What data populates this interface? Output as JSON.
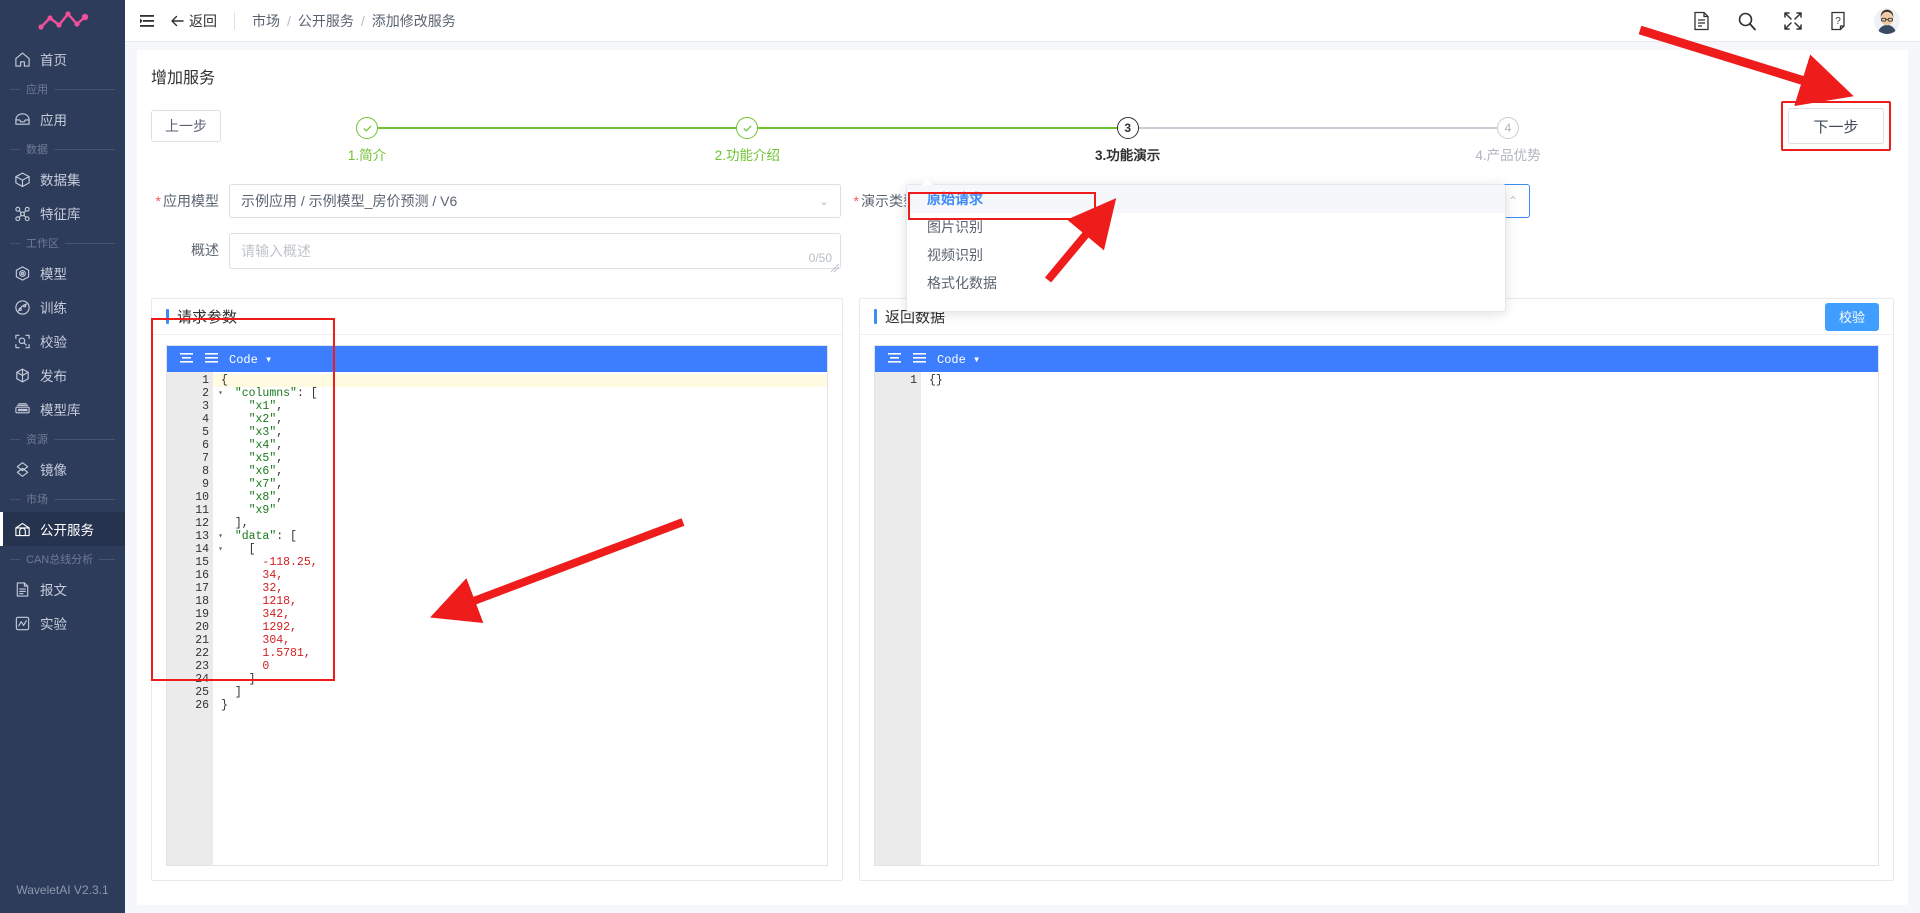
{
  "app": {
    "name": "WaveletAI V2.3.1",
    "logo_icon": "wave-logo-icon"
  },
  "sidebar": {
    "items": [
      {
        "type": "item",
        "label": "首页",
        "icon": "home-icon",
        "active": false
      },
      {
        "type": "group",
        "label": "应用"
      },
      {
        "type": "item",
        "label": "应用",
        "icon": "inbox-icon",
        "active": false
      },
      {
        "type": "group",
        "label": "数据"
      },
      {
        "type": "item",
        "label": "数据集",
        "icon": "cube-icon",
        "active": false
      },
      {
        "type": "item",
        "label": "特征库",
        "icon": "nodes-icon",
        "active": false
      },
      {
        "type": "group",
        "label": "工作区"
      },
      {
        "type": "item",
        "label": "模型",
        "icon": "model-icon",
        "active": false
      },
      {
        "type": "item",
        "label": "训练",
        "icon": "train-icon",
        "active": false
      },
      {
        "type": "item",
        "label": "校验",
        "icon": "verify-icon",
        "active": false
      },
      {
        "type": "item",
        "label": "发布",
        "icon": "package-icon",
        "active": false
      },
      {
        "type": "item",
        "label": "模型库",
        "icon": "library-icon",
        "active": false
      },
      {
        "type": "group",
        "label": "资源"
      },
      {
        "type": "item",
        "label": "镜像",
        "icon": "image-icon",
        "active": false
      },
      {
        "type": "group",
        "label": "市场"
      },
      {
        "type": "item",
        "label": "公开服务",
        "icon": "store-icon",
        "active": true
      },
      {
        "type": "group",
        "label": "CAN总线分析"
      },
      {
        "type": "item",
        "label": "报文",
        "icon": "doc-icon",
        "active": false
      },
      {
        "type": "item",
        "label": "实验",
        "icon": "experiment-icon",
        "active": false
      }
    ]
  },
  "topbar": {
    "collapse_icon": "menu-collapse-icon",
    "back_label": "返回",
    "back_icon": "arrow-left-icon",
    "breadcrumbs": [
      "市场",
      "公开服务",
      "添加修改服务"
    ],
    "separator": "/",
    "icons": [
      "document-icon",
      "search-icon",
      "fullscreen-icon",
      "help-icon"
    ],
    "avatar_icon": "user-avatar"
  },
  "page": {
    "title": "增加服务",
    "prev_button": "上一步",
    "next_button": "下一步"
  },
  "stepper": {
    "steps": [
      {
        "label": "1.简介",
        "marker": "check",
        "state": "done"
      },
      {
        "label": "2.功能介绍",
        "marker": "check",
        "state": "done"
      },
      {
        "label": "3.功能演示",
        "marker": "3",
        "state": "current"
      },
      {
        "label": "4.产品优势",
        "marker": "4",
        "state": "todo"
      }
    ],
    "done_color": "#6fc231",
    "todo_color": "#c8ccd4"
  },
  "form": {
    "app_model": {
      "label": "应用模型",
      "required": true,
      "value": "示例应用 / 示例模型_房价预测 / V6"
    },
    "summary": {
      "label": "概述",
      "required": false,
      "value": "",
      "placeholder": "请输入概述",
      "counter": "0/50"
    },
    "demo_type": {
      "label": "演示类型",
      "required": true,
      "value": "原始请求",
      "expanded": true,
      "options": [
        "原始请求",
        "图片识别",
        "视频识别",
        "格式化数据"
      ],
      "selected": "原始请求"
    }
  },
  "left_panel": {
    "title": "请求参数",
    "editor": {
      "mode_label": "Code",
      "toolbar_icons": [
        "compact-json-icon",
        "format-json-icon"
      ],
      "lines": [
        {
          "n": 1,
          "fold": true,
          "text": "{"
        },
        {
          "n": 2,
          "fold": true,
          "text": "  \"columns\": ["
        },
        {
          "n": 3,
          "fold": false,
          "text": "    \"x1\","
        },
        {
          "n": 4,
          "fold": false,
          "text": "    \"x2\","
        },
        {
          "n": 5,
          "fold": false,
          "text": "    \"x3\","
        },
        {
          "n": 6,
          "fold": false,
          "text": "    \"x4\","
        },
        {
          "n": 7,
          "fold": false,
          "text": "    \"x5\","
        },
        {
          "n": 8,
          "fold": false,
          "text": "    \"x6\","
        },
        {
          "n": 9,
          "fold": false,
          "text": "    \"x7\","
        },
        {
          "n": 10,
          "fold": false,
          "text": "    \"x8\","
        },
        {
          "n": 11,
          "fold": false,
          "text": "    \"x9\""
        },
        {
          "n": 12,
          "fold": false,
          "text": "  ],"
        },
        {
          "n": 13,
          "fold": true,
          "text": "  \"data\": ["
        },
        {
          "n": 14,
          "fold": true,
          "text": "    ["
        },
        {
          "n": 15,
          "fold": false,
          "text": "      -118.25,"
        },
        {
          "n": 16,
          "fold": false,
          "text": "      34,"
        },
        {
          "n": 17,
          "fold": false,
          "text": "      32,"
        },
        {
          "n": 18,
          "fold": false,
          "text": "      1218,"
        },
        {
          "n": 19,
          "fold": false,
          "text": "      342,"
        },
        {
          "n": 20,
          "fold": false,
          "text": "      1292,"
        },
        {
          "n": 21,
          "fold": false,
          "text": "      304,"
        },
        {
          "n": 22,
          "fold": false,
          "text": "      1.5781,"
        },
        {
          "n": 23,
          "fold": false,
          "text": "      0"
        },
        {
          "n": 24,
          "fold": false,
          "text": "    ]"
        },
        {
          "n": 25,
          "fold": false,
          "text": "  ]"
        },
        {
          "n": 26,
          "fold": false,
          "text": "}"
        }
      ]
    }
  },
  "right_panel": {
    "title": "返回数据",
    "validate_button": "校验",
    "editor": {
      "mode_label": "Code",
      "toolbar_icons": [
        "compact-json-icon",
        "format-json-icon"
      ],
      "lines": [
        {
          "n": 1,
          "fold": false,
          "text": "{}"
        }
      ]
    }
  },
  "annotations": {
    "highlight_color": "#ef1c1c",
    "boxes": [
      "next-button-box",
      "dropdown-option-box",
      "request-code-box"
    ],
    "arrows": [
      "arrow-to-next-button",
      "arrow-to-dropdown-option",
      "arrow-to-request-code"
    ]
  }
}
